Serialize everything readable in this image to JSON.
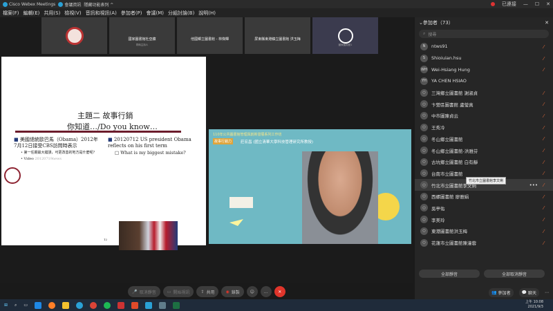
{
  "titlebar": {
    "app_name": "Cisco Webex Meetings",
    "meeting_info_label": "會議資訊",
    "hide_menu_label": "隱藏功能表列 ^",
    "user_status": "已連接"
  },
  "menubar": {
    "items": [
      "檔案(F)",
      "編輯(E)",
      "共用(S)",
      "檢視(V)",
      "音訊和視訊(A)",
      "參加者(P)",
      "會議(M)",
      "分組討論(B)",
      "說明(H)"
    ]
  },
  "thumbnails": [
    {
      "label": "",
      "sub": ""
    },
    {
      "label": "國家圖書館杜亞蘋",
      "sub": "同時主持人"
    },
    {
      "label": "他國鄉立圖書館 - 林傑輝",
      "sub": ""
    },
    {
      "label": "屏東縣東港鎮立圖書館 洪玉梅",
      "sub": ""
    },
    {
      "label": "",
      "sub": "國家圖書館1"
    }
  ],
  "slide": {
    "title_line1": "主題二 故事行銷",
    "title_line2": "你知道…/Do you know…",
    "left_bullet": "美國總統歐巴馬（Obama）2012年7月12日接受CBS訪問時表示",
    "left_sub1": "第一任期最大錯誤，可更改善的地方是什麼呢？",
    "left_sub2": "Video",
    "left_sub2_link": "20120719news",
    "right_bullet": "20120712 US president Obama reflects on his first term",
    "right_sub": "What is my biggest mistake?",
    "page_number": "12"
  },
  "video": {
    "banner": "110年公共圖書館管理與創新發展系列工作坊",
    "tag": "故事行銷力",
    "presenter": "莊宏昌 (國立清華大學科技管理研究所教授)"
  },
  "controls": {
    "mute": "取消靜音",
    "video": "開始視訊",
    "share": "共用",
    "record": "錄製",
    "more": "…"
  },
  "panel": {
    "title": "參加者（73）",
    "search_placeholder": "搜尋",
    "participants": [
      {
        "initials": "N",
        "name": "ntws91"
      },
      {
        "initials": "S",
        "name": "Shioiuian.hsu"
      },
      {
        "initials": "WH",
        "name": "Wei-Hsiang Hung"
      },
      {
        "initials": "YH",
        "name": "YA CHEN HSIAO"
      },
      {
        "initials": "",
        "name": "三灣鄉立圖書館 謝淑貞"
      },
      {
        "initials": "",
        "name": "卞營區圖書館 盧瑩真"
      },
      {
        "initials": "",
        "name": "中市圖陳貞云"
      },
      {
        "initials": "",
        "name": "王秀冷"
      },
      {
        "initials": "",
        "name": "冬山鄉立圖書館"
      },
      {
        "initials": "",
        "name": "冬山鄉立圖書館-洪雅芬"
      },
      {
        "initials": "",
        "name": "古坑鄉立圖書館 白有靜"
      },
      {
        "initials": "",
        "name": "台南市立圖書館"
      },
      {
        "initials": "",
        "name": "竹北市立圖書館李文俐"
      },
      {
        "initials": "",
        "name": "西螺圖書館 廖雅娟"
      },
      {
        "initials": "",
        "name": "吳亭佑"
      },
      {
        "initials": "",
        "name": "李美玲"
      },
      {
        "initials": "",
        "name": "東港圖書館洪玉梅"
      },
      {
        "initials": "",
        "name": "花蓮市立圖書館陳潼蓉"
      }
    ],
    "tooltip": "竹北市立圖書館李文俐",
    "mute_all": "全部靜音",
    "unmute_all": "全部取消靜音",
    "participants_tab": "參加者",
    "chat_tab": "聊天"
  },
  "taskbar": {
    "time": "上午 10:08",
    "date": "2021/9/3"
  }
}
